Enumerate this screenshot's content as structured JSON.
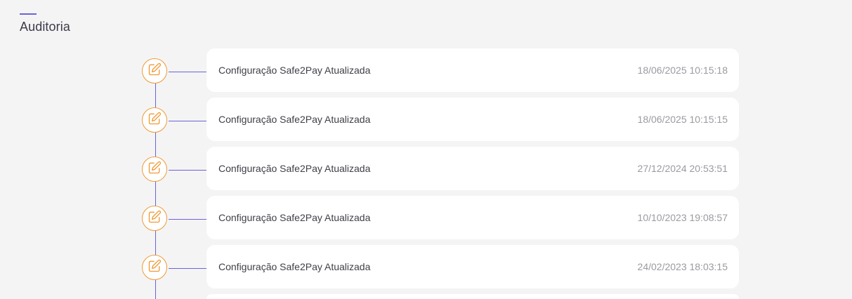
{
  "header": {
    "title": "Auditoria"
  },
  "colors": {
    "accent": "#6c63d9",
    "icon": "#f09a36",
    "background": "#f4f4f4",
    "card": "#ffffff"
  },
  "audit": {
    "entries": [
      {
        "text": "Configuração Safe2Pay Atualizada",
        "time": "18/06/2025 10:15:18",
        "icon": "edit-icon"
      },
      {
        "text": "Configuração Safe2Pay Atualizada",
        "time": "18/06/2025 10:15:15",
        "icon": "edit-icon"
      },
      {
        "text": "Configuração Safe2Pay Atualizada",
        "time": "27/12/2024 20:53:51",
        "icon": "edit-icon"
      },
      {
        "text": "Configuração Safe2Pay Atualizada",
        "time": "10/10/2023 19:08:57",
        "icon": "edit-icon"
      },
      {
        "text": "Configuração Safe2Pay Atualizada",
        "time": "24/02/2023 18:03:15",
        "icon": "edit-icon"
      }
    ]
  }
}
